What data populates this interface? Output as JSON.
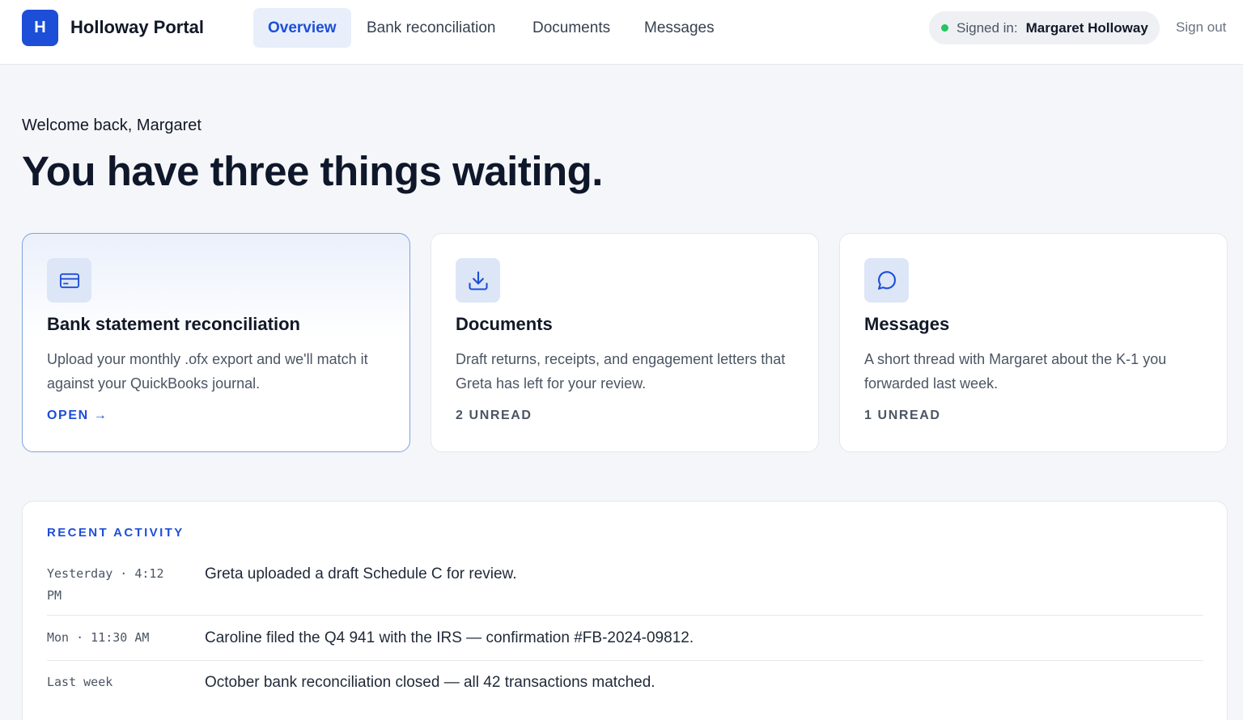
{
  "header": {
    "logo_letter": "H",
    "brand": "Holloway Portal",
    "nav": [
      {
        "label": "Overview",
        "active": true
      },
      {
        "label": "Bank reconciliation",
        "active": false
      },
      {
        "label": "Documents",
        "active": false
      },
      {
        "label": "Messages",
        "active": false
      }
    ],
    "signed_in_label": "Signed in:",
    "signed_in_name": "Margaret Holloway",
    "sign_out": "Sign out"
  },
  "hero": {
    "welcome": "Welcome back, Margaret",
    "headline": "You have three things waiting."
  },
  "cards": [
    {
      "icon": "credit-card-icon",
      "title": "Bank statement reconciliation",
      "description": "Upload your monthly .ofx export and we'll match it against your QuickBooks journal.",
      "meta": "OPEN →"
    },
    {
      "icon": "download-icon",
      "title": "Documents",
      "description": "Draft returns, receipts, and engagement letters that Greta has left for your review.",
      "meta": "2 UNREAD"
    },
    {
      "icon": "chat-bubble-icon",
      "title": "Messages",
      "description": "A short thread with Margaret about the K-1 you forwarded last week.",
      "meta": "1 UNREAD"
    }
  ],
  "activity": {
    "heading": "RECENT ACTIVITY",
    "items": [
      {
        "time": "Yesterday · 4:12 PM",
        "text": "Greta uploaded a draft Schedule C for review."
      },
      {
        "time": "Mon · 11:30 AM",
        "text": "Caroline filed the Q4 941 with the IRS — confirmation #FB-2024-09812."
      },
      {
        "time": "Last week",
        "text": "October bank reconciliation closed — all 42 transactions matched."
      }
    ]
  },
  "colors": {
    "accent": "#1d4ed8",
    "background": "#f5f6f9",
    "status_online": "#22c55e"
  }
}
